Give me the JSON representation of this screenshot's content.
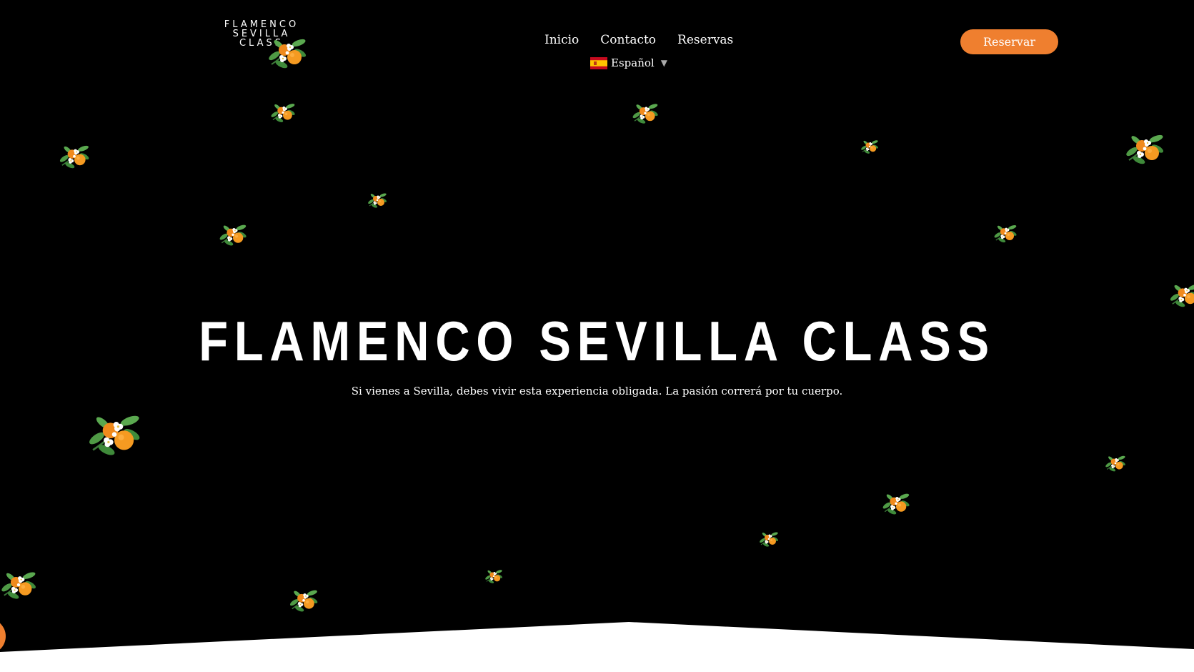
{
  "header": {
    "logo_lines": [
      "FLAMENCO",
      "SEVILLA",
      "CLASS"
    ],
    "nav": [
      {
        "label": "Inicio"
      },
      {
        "label": "Contacto"
      },
      {
        "label": "Reservas"
      }
    ],
    "language": {
      "selected": "Español",
      "flag": "spain-flag-icon"
    },
    "cta_label": "Reservar"
  },
  "hero": {
    "title": "FLAMENCO SEVILLA CLASS",
    "subtitle": "Si vienes a Sevilla, debes vivir esta experiencia obligada. La pasión correrá por tu cuerpo."
  },
  "colors": {
    "background": "#000000",
    "accent": "#ef7f2f",
    "text": "#ffffff",
    "section_below": "#ffffff"
  },
  "decorations": {
    "icon": "orange-blossom-sprig-icon"
  }
}
